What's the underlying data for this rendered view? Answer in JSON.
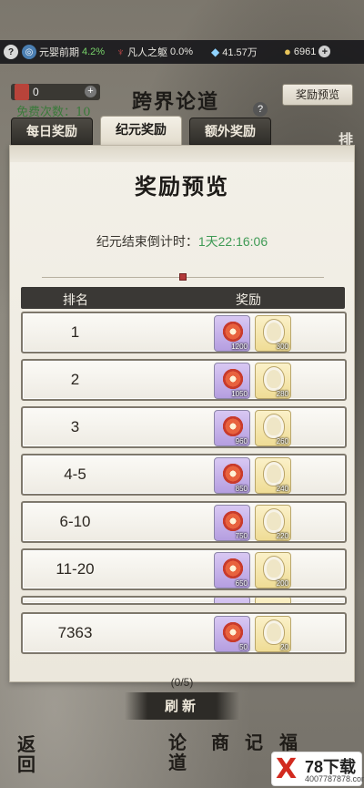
{
  "status_bar": {
    "help_icon": "?",
    "realm_name": "元婴前期",
    "realm_progress": "4.2%",
    "body_name": "凡人之躯",
    "body_progress": "0.0%",
    "spirit_stones": "41.57万",
    "coins": "6961",
    "plus": "+"
  },
  "header": {
    "ticket_count": "0",
    "ticket_plus": "+",
    "free_count_text": "免费次数：10",
    "title": "跨界论道",
    "help": "?",
    "preview_button": "奖励预览"
  },
  "tabs": [
    {
      "label": "每日奖励"
    },
    {
      "label": "纪元奖励"
    },
    {
      "label": "额外奖励"
    }
  ],
  "side_label": "排",
  "modal": {
    "title": "奖励预览",
    "countdown_label": "纪元结束倒计时：",
    "countdown_time": "1天22:16:06",
    "columns": {
      "rank": "排名",
      "reward": "奖励"
    },
    "rows": [
      {
        "rank": "1",
        "purple_count": "1200",
        "gold_count": "300"
      },
      {
        "rank": "2",
        "purple_count": "1050",
        "gold_count": "280"
      },
      {
        "rank": "3",
        "purple_count": "960",
        "gold_count": "260"
      },
      {
        "rank": "4-5",
        "purple_count": "850",
        "gold_count": "240"
      },
      {
        "rank": "6-10",
        "purple_count": "750",
        "gold_count": "220"
      },
      {
        "rank": "11-20",
        "purple_count": "650",
        "gold_count": "200"
      }
    ],
    "my_row": {
      "rank": "7363",
      "purple_count": "50",
      "gold_count": "20"
    }
  },
  "footer": {
    "page_text": "(0/5)",
    "refresh_button": "刷新",
    "nav": {
      "back": "返回",
      "debate": "论道",
      "shop": "商",
      "record": "记",
      "bless": "福"
    }
  },
  "watermark": {
    "logo": "X",
    "brand": "78下载",
    "url": "4007787878.com"
  }
}
